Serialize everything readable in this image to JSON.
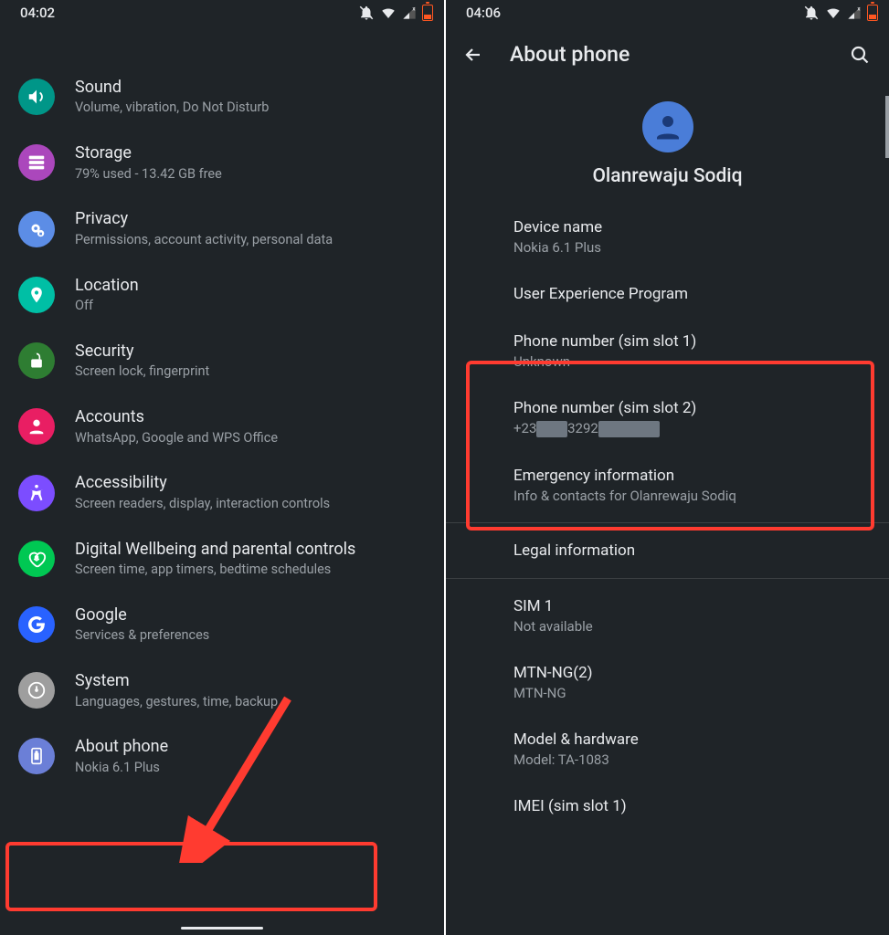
{
  "left": {
    "time": "04:02",
    "rows": [
      {
        "icon": "sound-icon",
        "bg": "#009688",
        "title": "Sound",
        "sub": "Volume, vibration, Do Not Disturb"
      },
      {
        "icon": "storage-icon",
        "bg": "#AB47BC",
        "title": "Storage",
        "sub": "79% used - 13.42 GB free"
      },
      {
        "icon": "privacy-icon",
        "bg": "#5C8DE6",
        "title": "Privacy",
        "sub": "Permissions, account activity, personal data"
      },
      {
        "icon": "location-icon",
        "bg": "#00BFA5",
        "title": "Location",
        "sub": "Off"
      },
      {
        "icon": "security-icon",
        "bg": "#2E7D32",
        "title": "Security",
        "sub": "Screen lock, fingerprint"
      },
      {
        "icon": "accounts-icon",
        "bg": "#E91E63",
        "title": "Accounts",
        "sub": "WhatsApp, Google and WPS Office"
      },
      {
        "icon": "a11y-icon",
        "bg": "#7C4DFF",
        "title": "Accessibility",
        "sub": "Screen readers, display, interaction controls"
      },
      {
        "icon": "wellbeing-icon",
        "bg": "#00C853",
        "title": "Digital Wellbeing and parental controls",
        "sub": "Screen time, app timers, bedtime schedules"
      },
      {
        "icon": "google-icon",
        "bg": "#2962FF",
        "title": "Google",
        "sub": "Services & preferences"
      },
      {
        "icon": "system-icon",
        "bg": "#9E9E9E",
        "title": "System",
        "sub": "Languages, gestures, time, backup"
      },
      {
        "icon": "about-icon",
        "bg": "#6B7FD7",
        "title": "About phone",
        "sub": "Nokia 6.1 Plus"
      }
    ]
  },
  "right": {
    "time": "04:06",
    "header": "About phone",
    "profile_name": "Olanrewaju Sodiq",
    "items": [
      {
        "title": "Device name",
        "sub": "Nokia 6.1 Plus"
      },
      {
        "title": "User Experience Program",
        "sub": ""
      },
      {
        "title": "Phone number (sim slot 1)",
        "sub": "Unknown"
      },
      {
        "title": "Phone number (sim slot 2)",
        "sub": "+23██3292████"
      },
      {
        "title": "Emergency information",
        "sub": "Info & contacts for Olanrewaju Sodiq"
      },
      {
        "title": "Legal information",
        "sub": ""
      },
      {
        "title": "SIM 1",
        "sub": "Not available"
      },
      {
        "title": "MTN-NG(2)",
        "sub": "MTN-NG"
      },
      {
        "title": "Model & hardware",
        "sub": "Model: TA-1083"
      },
      {
        "title": "IMEI (sim slot 1)",
        "sub": ""
      }
    ]
  }
}
